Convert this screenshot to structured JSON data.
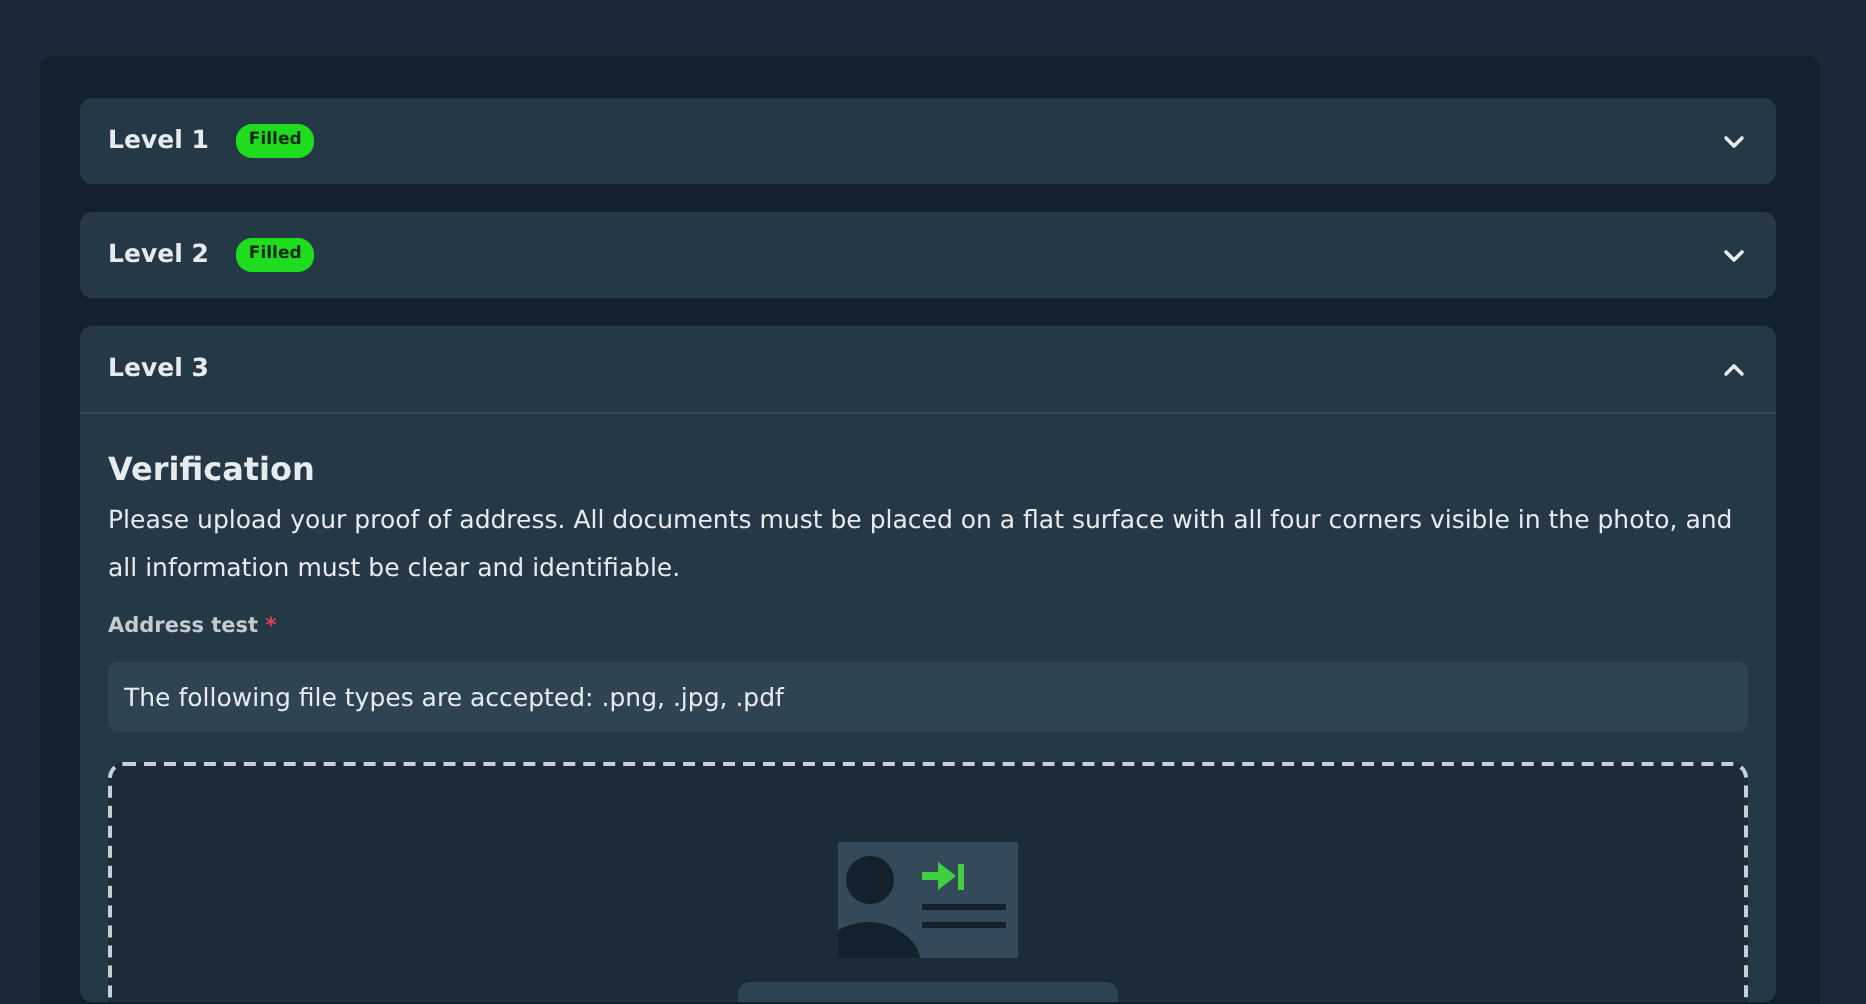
{
  "levels": [
    {
      "title": "Level 1",
      "badge": "Filled",
      "expanded": false
    },
    {
      "title": "Level 2",
      "badge": "Filled",
      "expanded": false
    },
    {
      "title": "Level 3",
      "expanded": true,
      "content": {
        "heading": "Verification",
        "description": "Please upload your proof of address. All documents must be placed on a flat surface with all four corners visible in the photo, and all information must be clear and identifiable.",
        "field": {
          "label": "Address test",
          "required_mark": "*",
          "value": "The following file types are accepted: .png, .jpg, .pdf"
        }
      }
    }
  ]
}
